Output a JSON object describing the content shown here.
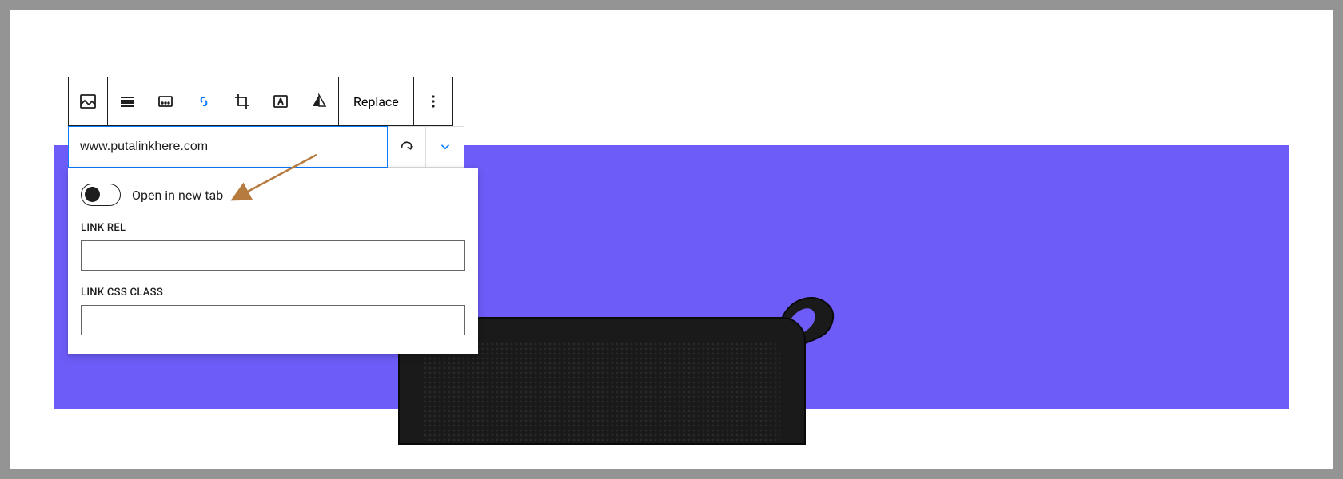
{
  "toolbar": {
    "replace_label": "Replace"
  },
  "link": {
    "url_value": "www.putalinkhere.com",
    "open_new_tab_label": "Open in new tab",
    "rel_label": "LINK REL",
    "rel_value": "",
    "css_class_label": "LINK CSS CLASS",
    "css_class_value": ""
  },
  "colors": {
    "accent": "#0a7cff",
    "canvas": "#6d5cf7",
    "arrow": "#b57b3f"
  }
}
